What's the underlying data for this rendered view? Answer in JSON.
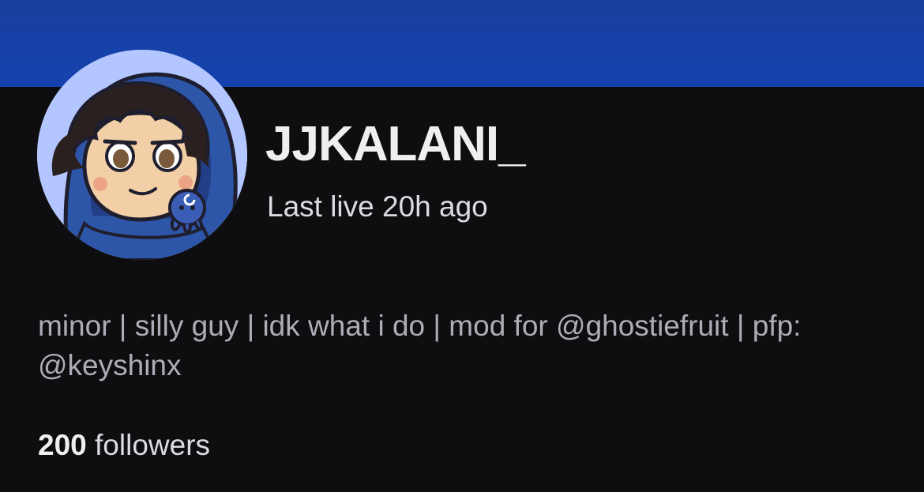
{
  "profile": {
    "username": "JJKALANI_",
    "last_live": "Last live 20h ago",
    "bio": "minor | silly guy | idk what i do | mod for @ghostiefruit | pfp: @keyshinx",
    "followers_count": "200",
    "followers_label": "followers",
    "avatar_icon": "profile-avatar-illustration"
  },
  "colors": {
    "banner": "#1443b0",
    "background": "#0e0e10",
    "avatar_bg": "#b3c6ff"
  }
}
